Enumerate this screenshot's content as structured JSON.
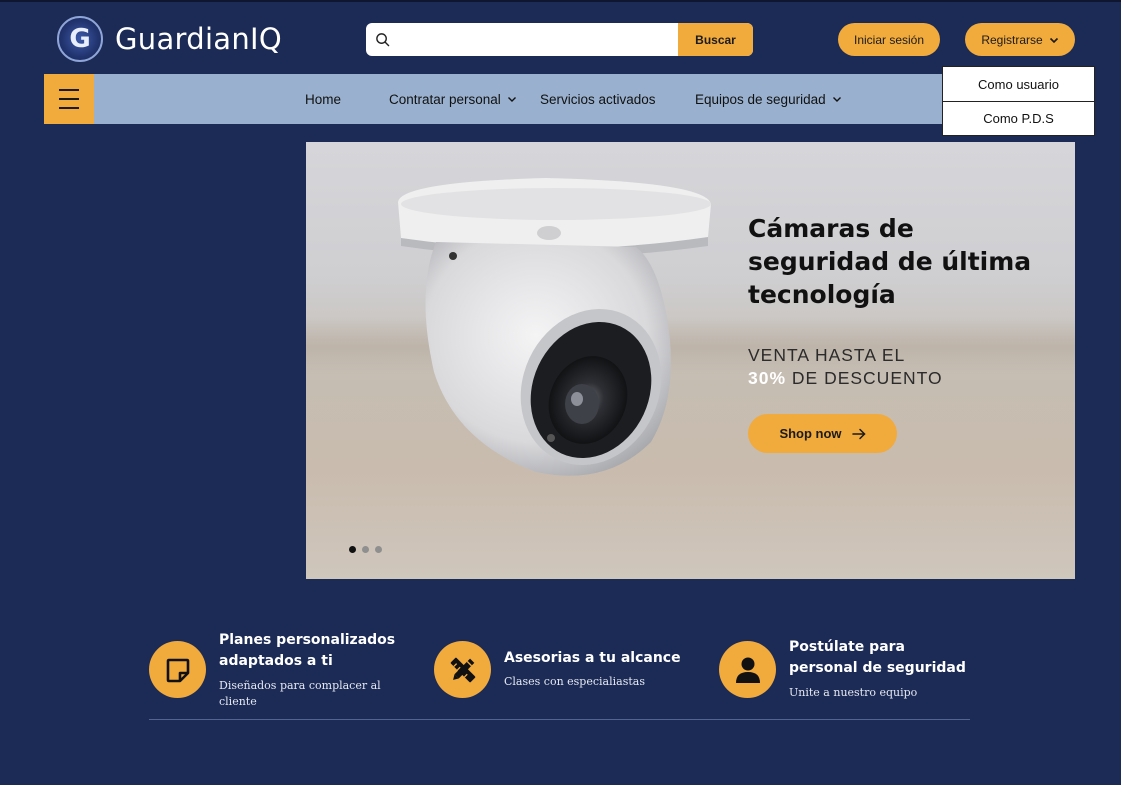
{
  "brand": {
    "name": "GuardianIQ",
    "logo_letter": "G"
  },
  "search": {
    "placeholder": "",
    "button_label": "Buscar"
  },
  "header": {
    "login_label": "Iniciar sesión",
    "register_label": "Registrarse"
  },
  "register_menu": {
    "items": [
      "Como usuario",
      "Como P.D.S"
    ]
  },
  "nav": {
    "home": "Home",
    "hire": "Contratar personal",
    "services": "Servicios activados",
    "equipment": "Equipos de seguridad"
  },
  "hero": {
    "title": "Cámaras de seguridad de última tecnología",
    "subtitle_line1": "VENTA HASTA EL",
    "subtitle_highlight": "30%",
    "subtitle_line2": " DE DESCUENTO",
    "cta_label": "Shop now",
    "slides": 3,
    "active_slide": 1
  },
  "features": [
    {
      "icon": "note-icon",
      "title": "Planes personalizados adaptados a ti",
      "desc": "Diseñados para complacer al cliente"
    },
    {
      "icon": "pencil-ruler-icon",
      "title": "Asesorias a tu alcance",
      "desc": "Clases con especialiastas"
    },
    {
      "icon": "user-icon",
      "title": "Postúlate para personal de seguridad",
      "desc": "Unite a nuestro equipo"
    }
  ],
  "colors": {
    "background": "#1c2b56",
    "accent": "#f1aa3c",
    "navbar": "#99b1cf"
  }
}
